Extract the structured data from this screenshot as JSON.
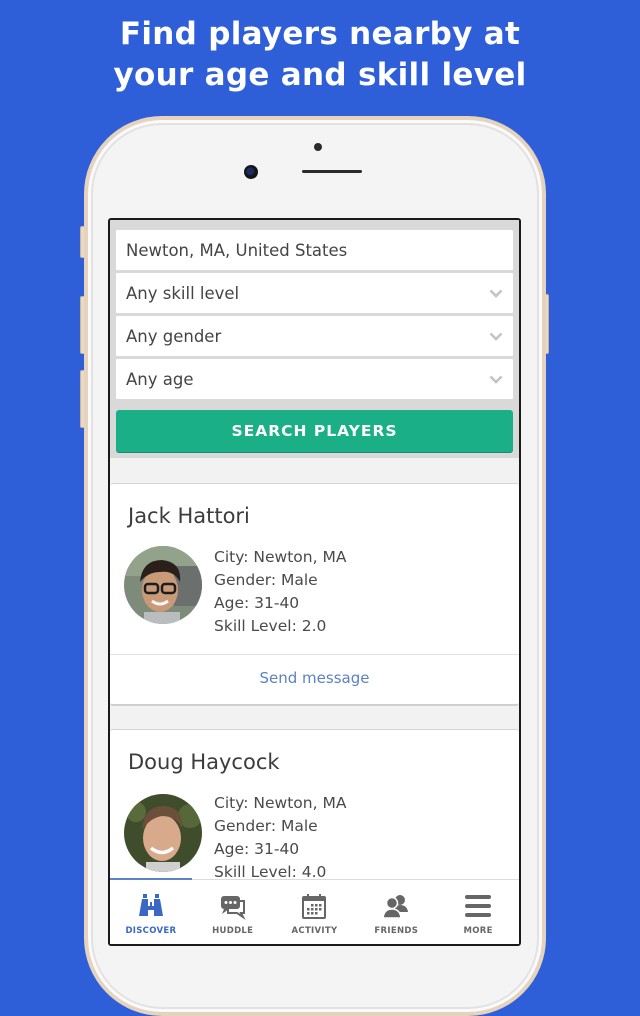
{
  "headline": {
    "line1": "Find players nearby at",
    "line2": "your age and skill level"
  },
  "colors": {
    "background": "#2e5fd8",
    "accent_green": "#1aaf87",
    "link_blue": "#5b82c4",
    "tab_active": "#3a68c4"
  },
  "filters": {
    "location": {
      "value": "Newton, MA, United States",
      "placeholder": ""
    },
    "skill_level": {
      "selected": "Any skill level",
      "icon": "chevron-down-icon"
    },
    "gender": {
      "selected": "Any gender",
      "icon": "chevron-down-icon"
    },
    "age": {
      "selected": "Any age",
      "icon": "chevron-down-icon"
    },
    "search_button": "SEARCH PLAYERS"
  },
  "players": [
    {
      "name": "Jack Hattori",
      "city": "City: Newton, MA",
      "gender": "Gender: Male",
      "age": "Age: 31-40",
      "skill": "Skill Level: 2.0",
      "action": "Send message"
    },
    {
      "name": "Doug Haycock",
      "city": "City: Newton, MA",
      "gender": "Gender: Male",
      "age": "Age: 31-40",
      "skill": "Skill Level: 4.0"
    }
  ],
  "tabs": [
    {
      "label": "DISCOVER",
      "icon": "binoculars-icon",
      "active": true
    },
    {
      "label": "HUDDLE",
      "icon": "chat-bubbles-icon",
      "active": false
    },
    {
      "label": "ACTIVITY",
      "icon": "calendar-icon",
      "active": false
    },
    {
      "label": "FRIENDS",
      "icon": "friends-icon",
      "active": false
    },
    {
      "label": "MORE",
      "icon": "menu-icon",
      "active": false
    }
  ]
}
